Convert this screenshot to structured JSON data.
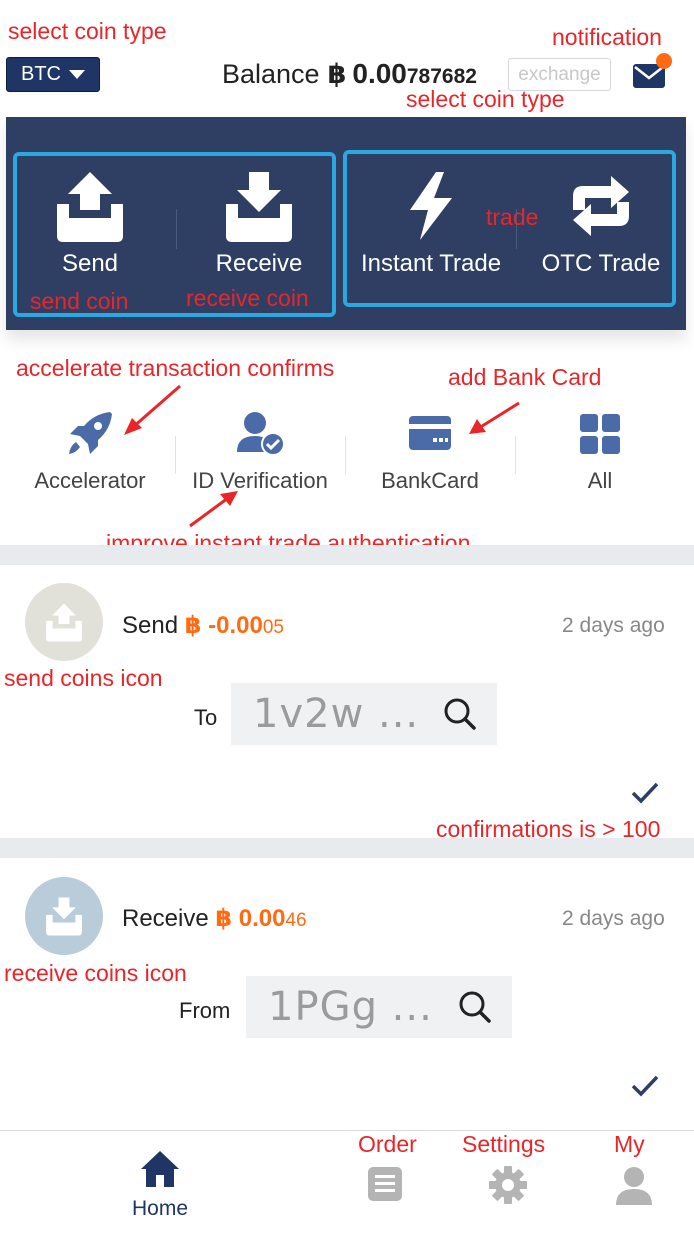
{
  "annotations": {
    "select_coin_type": "select coin type",
    "notification": "notification",
    "select_coin_type_2": "select coin type",
    "trade": "trade",
    "send_coin": "send coin",
    "receive_coin": "receive coin",
    "accelerate": "accelerate transaction confirms",
    "add_bank_card": "add Bank Card",
    "improve_auth": "improve instant trade authentication",
    "send_coins_icon": "send coins icon",
    "confirmations": "confirmations is > 100",
    "receive_coins_icon": "receive coins icon",
    "order": "Order",
    "settings": "Settings",
    "my": "My"
  },
  "header": {
    "coin_select": "BTC",
    "balance_label": "Balance",
    "balance_symbol": "฿",
    "balance_big": "0.00",
    "balance_small": "787682",
    "exchange": "exchange"
  },
  "actions": {
    "send": "Send",
    "receive": "Receive",
    "instant_trade": "Instant Trade",
    "otc_trade": "OTC Trade"
  },
  "quick": {
    "accelerator": "Accelerator",
    "id_verification": "ID Verification",
    "bankcard": "BankCard",
    "all": "All"
  },
  "transactions": [
    {
      "type": "Send",
      "amount_symbol": "฿",
      "amount_big": "-0.00",
      "amount_small": "05",
      "time": "2 days ago",
      "address_label": "To",
      "address": "1v2w ..."
    },
    {
      "type": "Receive",
      "amount_symbol": "฿",
      "amount_big": "0.00",
      "amount_small": "46",
      "time": "2 days ago",
      "address_label": "From",
      "address": "1PGg ..."
    }
  ],
  "nav": {
    "home": "Home"
  },
  "colors": {
    "brand_navy": "#2f3f64",
    "accent_orange": "#ff6a13",
    "highlight_box": "#2ba8e0",
    "annotation_red": "#e8262a"
  }
}
